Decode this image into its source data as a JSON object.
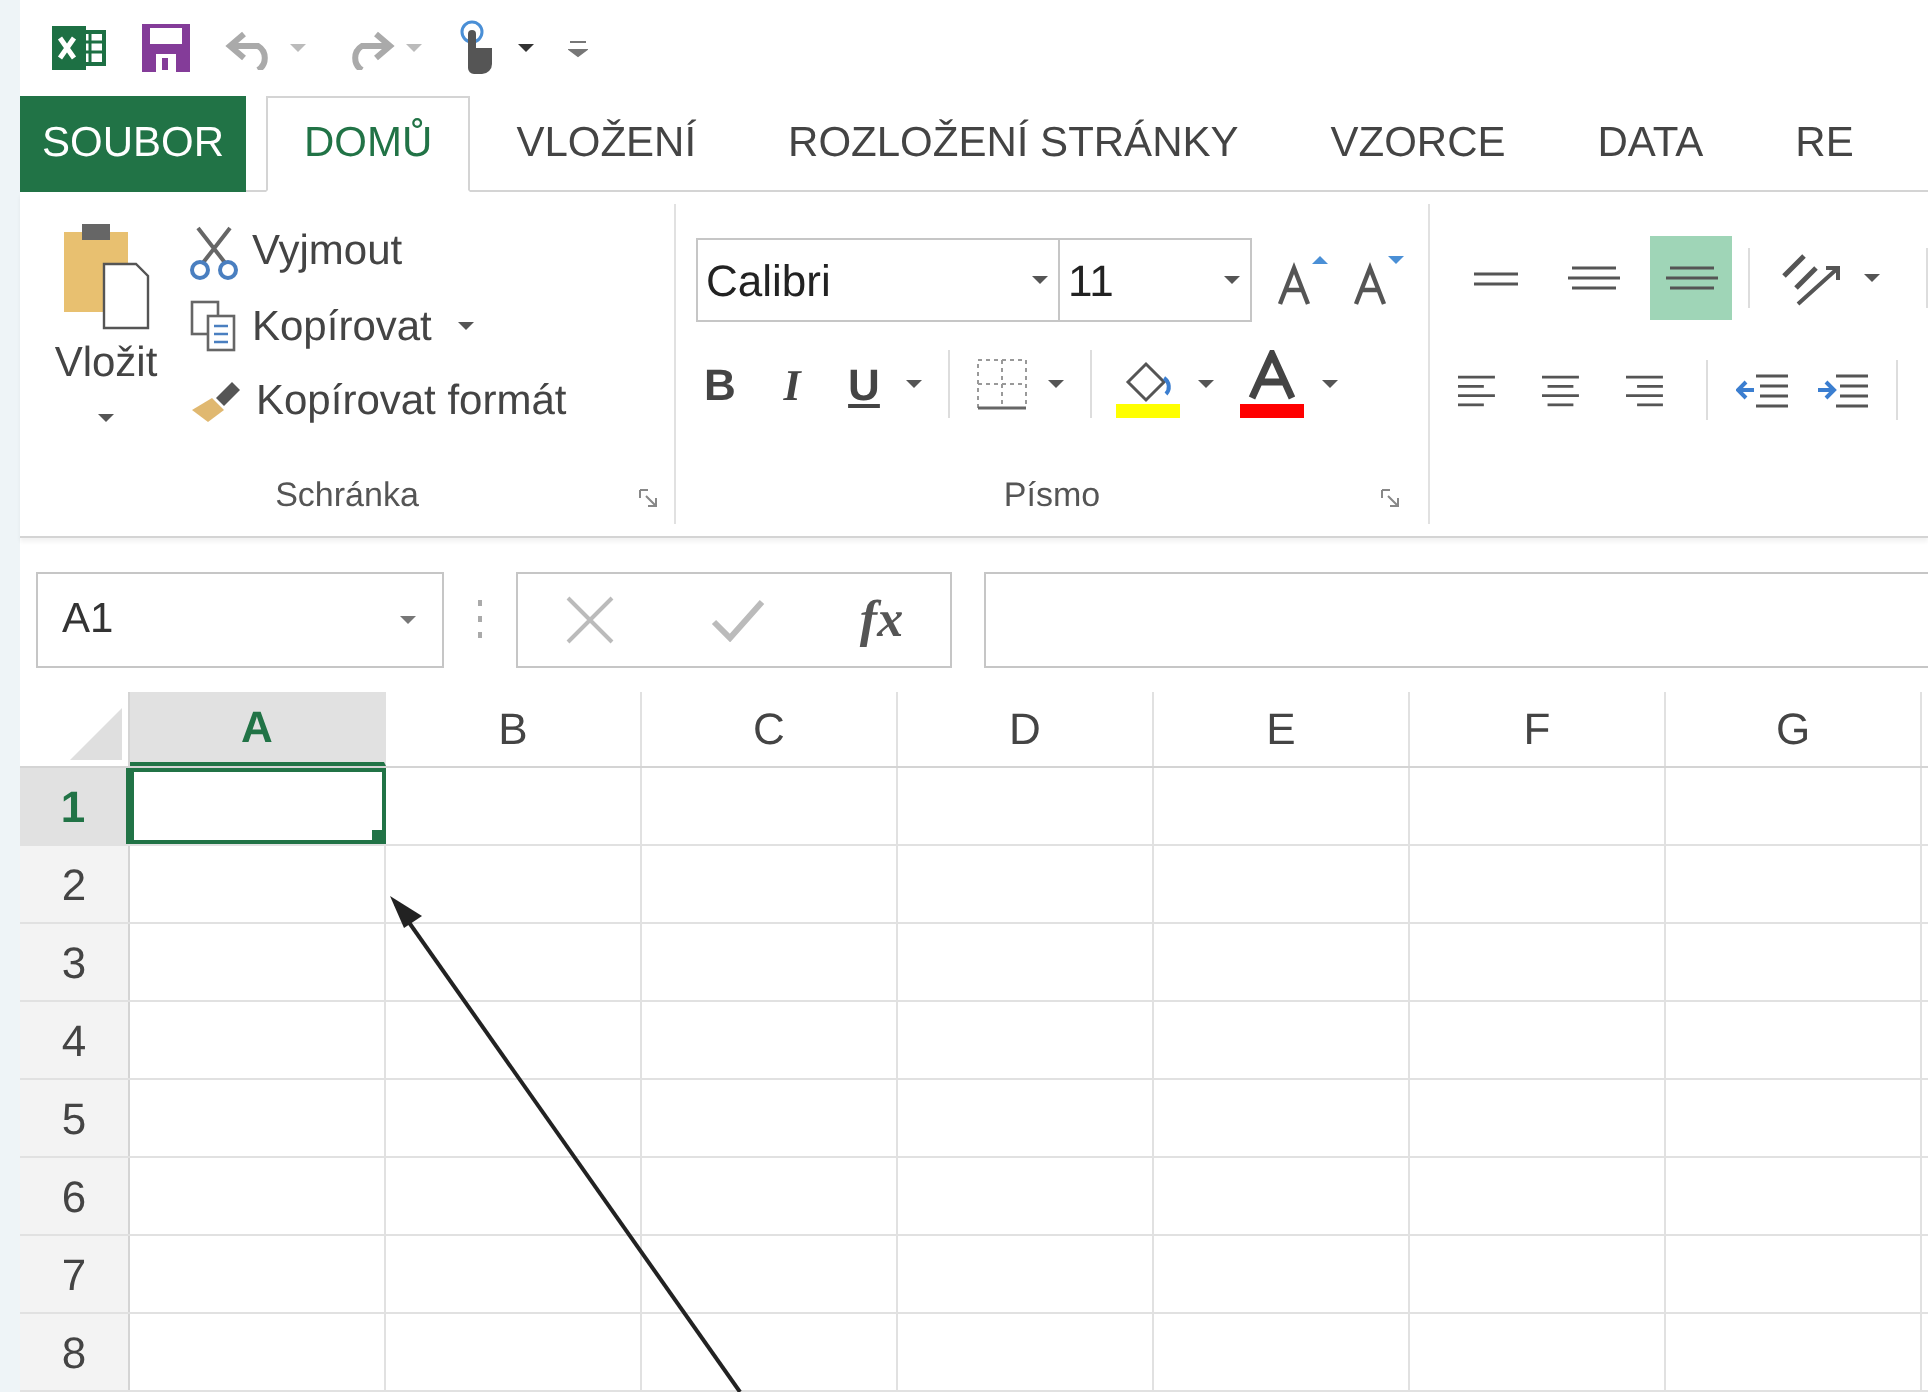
{
  "tabs": [
    {
      "label": "SOUBOR",
      "kind": "file",
      "selected": false
    },
    {
      "label": "DOMŮ",
      "kind": "tab",
      "selected": true
    },
    {
      "label": "VLOŽENÍ",
      "kind": "tab",
      "selected": false
    },
    {
      "label": "ROZLOŽENÍ STRÁNKY",
      "kind": "tab",
      "selected": false
    },
    {
      "label": "VZORCE",
      "kind": "tab",
      "selected": false
    },
    {
      "label": "DATA",
      "kind": "tab",
      "selected": false
    },
    {
      "label": "RE",
      "kind": "tab",
      "selected": false
    }
  ],
  "clipboard": {
    "paste": "Vložit",
    "cut": "Vyjmout",
    "copy": "Kopírovat",
    "format_painter": "Kopírovat formát",
    "group_label": "Schránka"
  },
  "font": {
    "name": "Calibri",
    "size": "11",
    "bold": "B",
    "italic": "I",
    "underline": "U",
    "group_label": "Písmo"
  },
  "vertical_alignment": [
    {
      "kind": "top",
      "selected": false
    },
    {
      "kind": "middle",
      "selected": false
    },
    {
      "kind": "bottom",
      "selected": true
    }
  ],
  "name_box": {
    "value": "A1"
  },
  "formula_bar": {
    "function_label": "fx"
  },
  "sheet": {
    "columns": [
      {
        "label": "A",
        "selected": true
      },
      {
        "label": "B",
        "selected": false
      },
      {
        "label": "C",
        "selected": false
      },
      {
        "label": "D",
        "selected": false
      },
      {
        "label": "E",
        "selected": false
      },
      {
        "label": "F",
        "selected": false
      },
      {
        "label": "G",
        "selected": false
      }
    ],
    "rows": [
      {
        "label": "1",
        "selected": true
      },
      {
        "label": "2",
        "selected": false
      },
      {
        "label": "3",
        "selected": false
      },
      {
        "label": "4",
        "selected": false
      },
      {
        "label": "5",
        "selected": false
      },
      {
        "label": "6",
        "selected": false
      },
      {
        "label": "7",
        "selected": false
      },
      {
        "label": "8",
        "selected": false
      }
    ]
  }
}
